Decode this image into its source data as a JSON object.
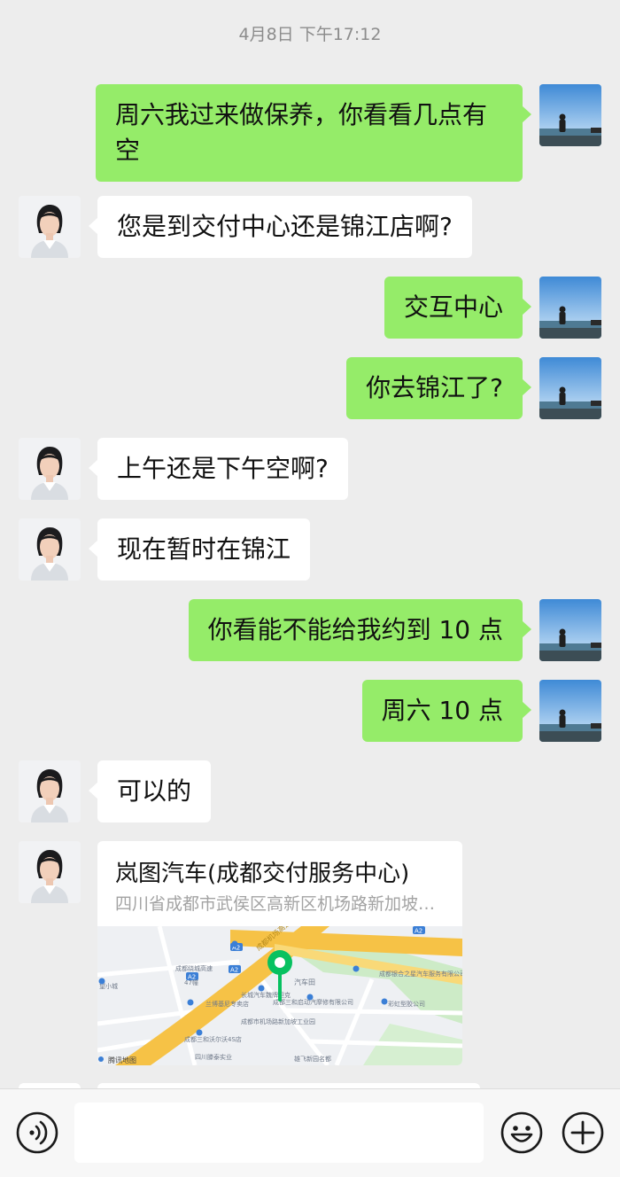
{
  "timestamp": "4月8日 下午17:12",
  "messages": [
    {
      "side": "out",
      "text": "周六我过来做保养，你看看几点有空"
    },
    {
      "side": "in",
      "text": "您是到交付中心还是锦江店啊?"
    },
    {
      "side": "out",
      "text": "交互中心"
    },
    {
      "side": "out",
      "text": "你去锦江了?"
    },
    {
      "side": "in",
      "text": "上午还是下午空啊?"
    },
    {
      "side": "in",
      "text": "现在暂时在锦江"
    },
    {
      "side": "out",
      "text": "你看能不能给我约到 10 点"
    },
    {
      "side": "out",
      "text": "周六 10 点"
    },
    {
      "side": "in",
      "text": "可以的"
    }
  ],
  "location_card": {
    "title": "岚图汽车(成都交付服务中心)",
    "address": "四川省成都市武侯区高新区机场路新加坡工业园",
    "map": {
      "road_badges": [
        "A2",
        "A2",
        "A2",
        "A2"
      ],
      "road_name": "成都机场高速",
      "labels": [
        "成都绕城高速",
        "47幢",
        "望小城",
        "长城汽车魏牌坦克",
        "兰博基尼专卖店",
        "汽车田",
        "成都银合之星汽车服务有限公司",
        "成都三和启动汽摩修有限公司",
        "彩虹型胶公司",
        "成都市机场路新加坡工业园",
        "成都三和沃尔沃4S店",
        "四川滕泰实业",
        "雄飞新园名都",
        "腾讯地图"
      ]
    }
  },
  "input_bar": {
    "voice_icon": "voice-icon",
    "emoji_icon": "emoji-icon",
    "plus_icon": "plus-icon",
    "placeholder": ""
  },
  "colors": {
    "background": "#ededed",
    "outgoing_bubble": "#95ec69",
    "incoming_bubble": "#ffffff",
    "map_pin": "#07c160"
  }
}
